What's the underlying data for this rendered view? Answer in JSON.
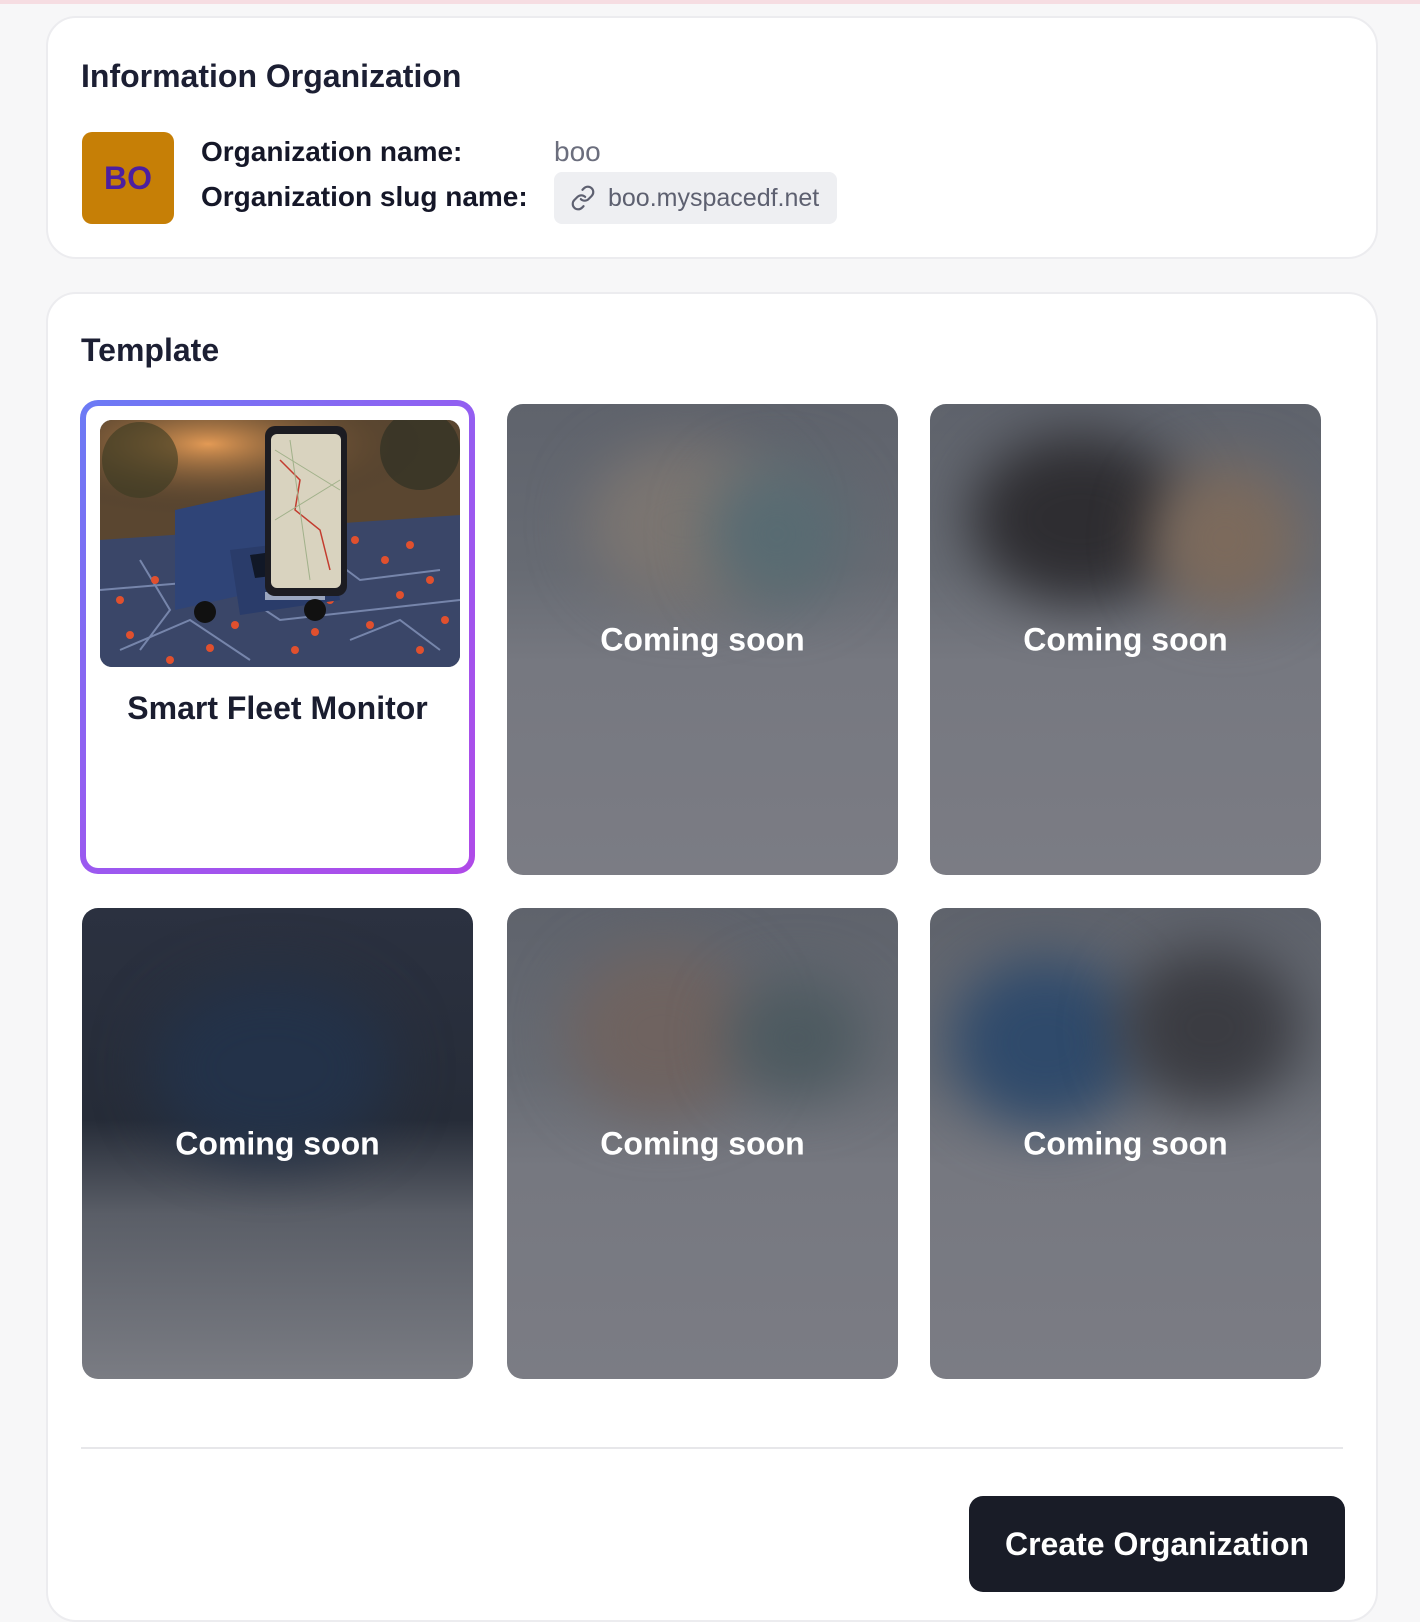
{
  "info": {
    "title": "Information Organization",
    "avatar_initials": "BO",
    "avatar_color": "#c67f06",
    "name_label": "Organization name:",
    "name_value": "boo",
    "slug_label": "Organization slug name:",
    "slug_value": "boo.myspacedf.net",
    "slug_icon": "link-icon"
  },
  "template": {
    "title": "Template",
    "selected_title": "Smart Fleet Monitor",
    "coming_soon": [
      "Coming soon",
      "Coming soon",
      "Coming soon",
      "Coming soon",
      "Coming soon"
    ]
  },
  "actions": {
    "create_label": "Create Organization"
  },
  "colors": {
    "selected_border_start": "#6b7bf5",
    "selected_border_end": "#b04ae8",
    "primary_button": "#191c27"
  }
}
